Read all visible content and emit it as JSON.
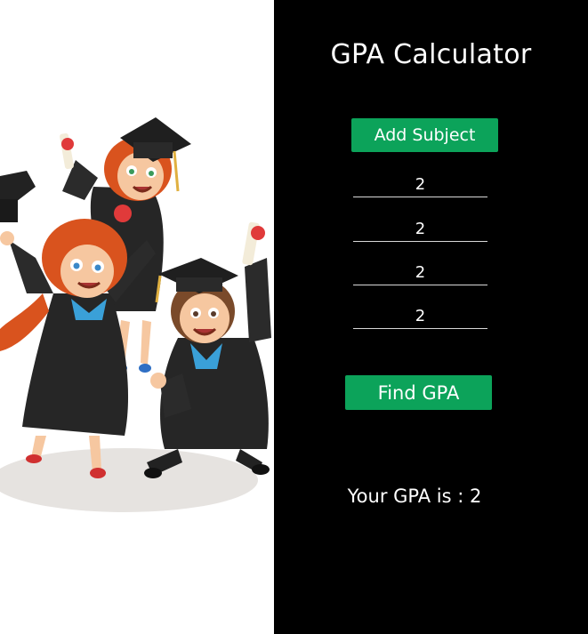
{
  "app": {
    "title": "GPA Calculator"
  },
  "controls": {
    "add_subject_label": "Add Subject",
    "find_gpa_label": "Find GPA"
  },
  "subjects": [
    {
      "grade": "2"
    },
    {
      "grade": "2"
    },
    {
      "grade": "2"
    },
    {
      "grade": "2"
    }
  ],
  "result": {
    "text": "Your GPA is : 2"
  },
  "illustration": {
    "name": "graduating-students-illustration",
    "colors": {
      "gown": "#2b2b2b",
      "hair": "#d9531e",
      "scroll_ribbon": "#e03a3a",
      "collar": "#3aa0d8",
      "skin": "#f6c7a0"
    }
  },
  "colors": {
    "accent": "#0ca35a",
    "panel_bg": "#000000",
    "image_bg": "#ffffff",
    "text": "#ffffff"
  }
}
